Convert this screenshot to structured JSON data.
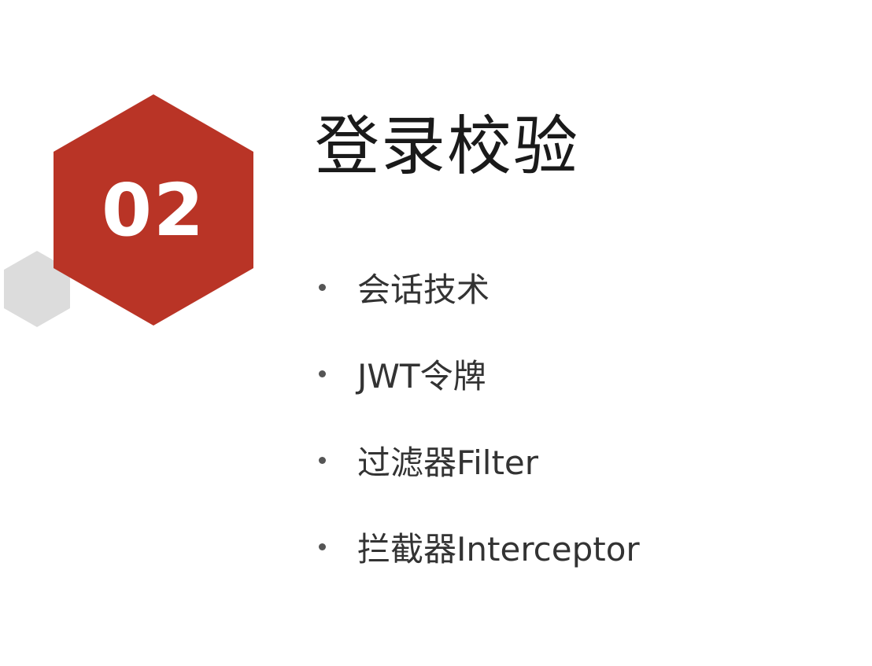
{
  "section": {
    "number": "02"
  },
  "title": "登录校验",
  "bullets": [
    {
      "text": "会话技术"
    },
    {
      "text": "JWT令牌"
    },
    {
      "text": "过滤器Filter"
    },
    {
      "text": "拦截器Interceptor"
    }
  ],
  "colors": {
    "accent": "#b93426",
    "hex_gray": "#dcdcdc",
    "background": "#ffffff"
  }
}
